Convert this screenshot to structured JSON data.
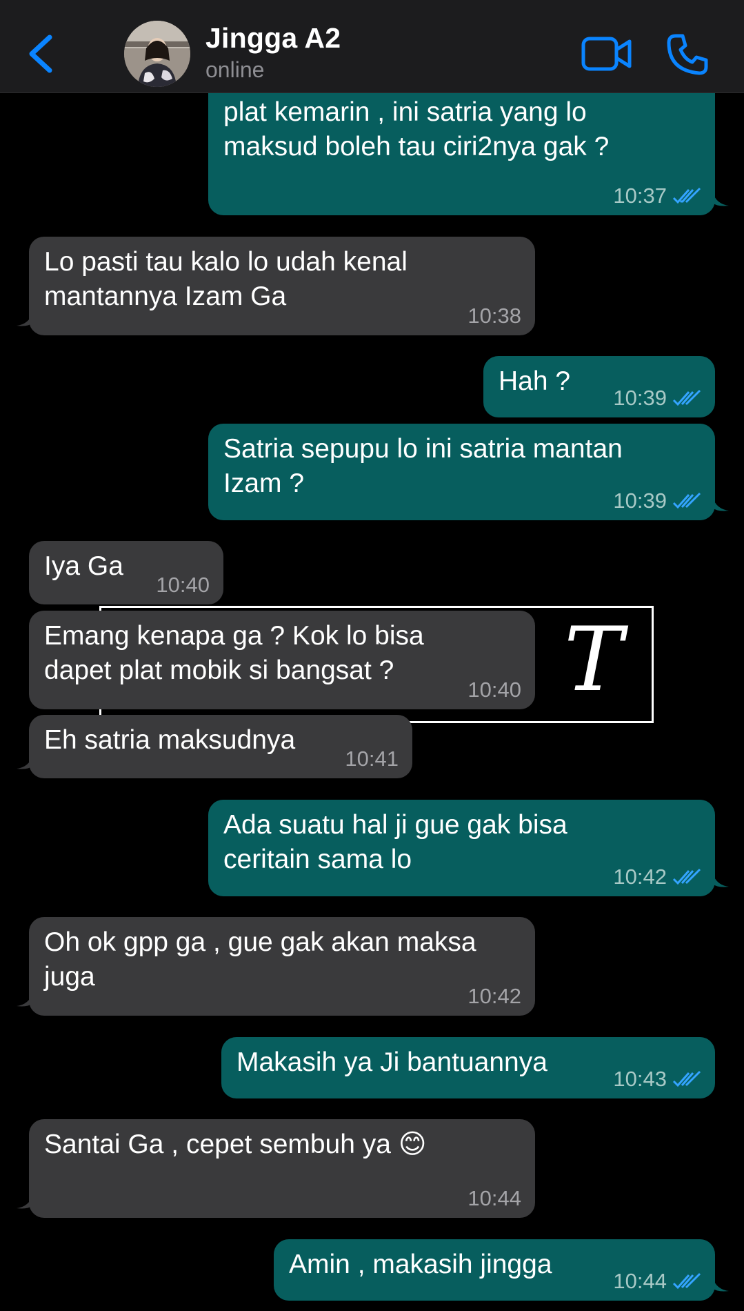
{
  "header": {
    "contact_name": "Jingga A2",
    "status": "online",
    "back_icon": "chevron-left-icon",
    "video_icon": "video-camera-icon",
    "call_icon": "phone-icon",
    "accent_color": "#0a84ff"
  },
  "colors": {
    "incoming_bubble": "#3a3a3c",
    "outgoing_bubble": "#075e5e",
    "read_ticks": "#34a4ff"
  },
  "messages": [
    {
      "direction": "out",
      "text": "plat kemarin , ini satria yang lo\nmaksud boleh tau ciri2nya gak ?",
      "time": "10:37",
      "read": true
    },
    {
      "direction": "in",
      "text": "Lo pasti tau kalo lo udah kenal\nmantannya Izam Ga",
      "time": "10:38"
    },
    {
      "direction": "out",
      "text": "Hah ?",
      "time": "10:39",
      "read": true
    },
    {
      "direction": "out",
      "text": "Satria sepupu lo ini satria mantan\nIzam ?",
      "time": "10:39",
      "read": true
    },
    {
      "direction": "in",
      "text": "Iya Ga",
      "time": "10:40"
    },
    {
      "direction": "in",
      "text": "Emang kenapa ga ? Kok lo bisa\ndapet plat mobik si bangsat ?",
      "time": "10:40"
    },
    {
      "direction": "in",
      "text": "Eh satria maksudnya",
      "time": "10:41"
    },
    {
      "direction": "out",
      "text": "Ada suatu hal ji gue gak bisa\nceritain sama lo",
      "time": "10:42",
      "read": true
    },
    {
      "direction": "in",
      "text": "Oh ok gpp ga , gue gak akan maksa\njuga",
      "time": "10:42"
    },
    {
      "direction": "out",
      "text": "Makasih ya Ji bantuannya",
      "time": "10:43",
      "read": true
    },
    {
      "direction": "in",
      "text": "Santai Ga , cepet sembuh ya 😊",
      "time": "10:44"
    },
    {
      "direction": "out",
      "text": "Amin , makasih jingga",
      "time": "10:44",
      "read": true
    }
  ],
  "overlay": {
    "glyph": "T",
    "icon": "text-tool-icon"
  }
}
